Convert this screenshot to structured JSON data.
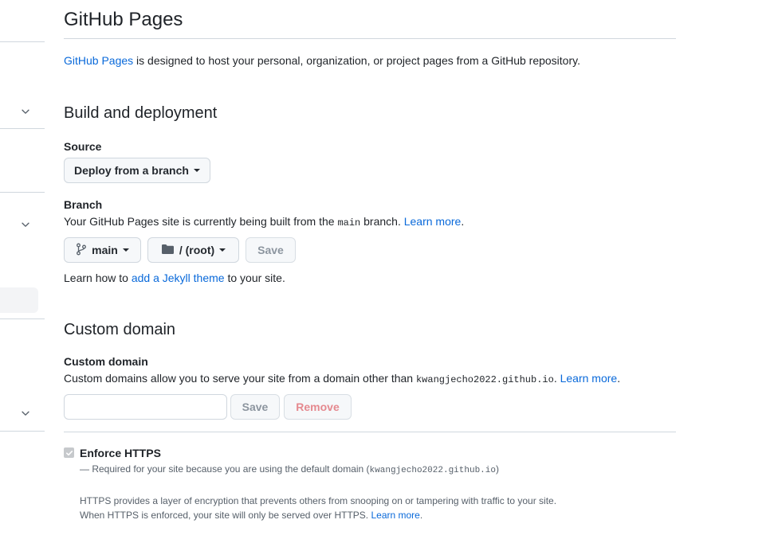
{
  "page": {
    "title": "GitHub Pages"
  },
  "intro": {
    "link": "GitHub Pages",
    "text": " is designed to host your personal, organization, or project pages from a GitHub repository."
  },
  "build": {
    "heading": "Build and deployment",
    "source_label": "Source",
    "source_value": "Deploy from a branch",
    "branch_label": "Branch",
    "branch_desc_pre": "Your GitHub Pages site is currently being built from the ",
    "branch_code": "main",
    "branch_desc_post": " branch. ",
    "learn_more": "Learn more",
    "period": ".",
    "branch_select": "main",
    "folder_select": "/ (root)",
    "save": "Save",
    "jekyll_pre": "Learn how to ",
    "jekyll_link": "add a Jekyll theme",
    "jekyll_post": " to your site."
  },
  "domain": {
    "heading": "Custom domain",
    "label": "Custom domain",
    "desc_pre": "Custom domains allow you to serve your site from a domain other than ",
    "desc_code": "kwangjecho2022.github.io",
    "desc_post": ". ",
    "learn_more": "Learn more",
    "period": ".",
    "input_value": "",
    "save": "Save",
    "remove": "Remove"
  },
  "https": {
    "label": "Enforce HTTPS",
    "checked": true,
    "required_pre": "— Required for your site because you are using the default domain (",
    "required_code": "kwangjecho2022.github.io",
    "required_post": ")",
    "info_line1": "HTTPS provides a layer of encryption that prevents others from snooping on or tampering with traffic to your site.",
    "info_line2_pre": "When HTTPS is enforced, your site will only be served over HTTPS. ",
    "learn_more": "Learn more",
    "period": "."
  },
  "colors": {
    "link": "#0969da",
    "border": "#d0d7de",
    "button_bg": "#f6f8fa",
    "muted": "#57606a"
  },
  "icons": {
    "sidebar_chevrons": [
      "chevron-down-icon",
      "chevron-down-icon",
      "chevron-down-icon"
    ],
    "branch": "git-branch-icon",
    "folder": "folder-icon",
    "check": "check-icon"
  }
}
